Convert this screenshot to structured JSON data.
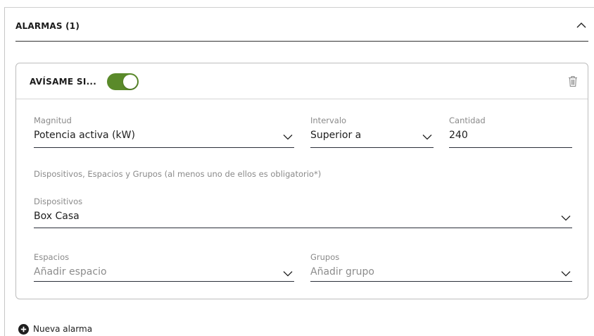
{
  "section": {
    "title": "ALARMAS (1)"
  },
  "alarm": {
    "title": "AVÍSAME SI...",
    "enabled": true,
    "magnitud": {
      "label": "Magnitud",
      "value": "Potencia activa (kW)"
    },
    "intervalo": {
      "label": "Intervalo",
      "value": "Superior a"
    },
    "cantidad": {
      "label": "Cantidad",
      "value": "240"
    },
    "hint": "Dispositivos, Espacios y Grupos (al menos uno de ellos es obligatorio*)",
    "dispositivos": {
      "label": "Dispositivos",
      "value": "Box Casa"
    },
    "espacios": {
      "label": "Espacios",
      "placeholder": "Añadir espacio"
    },
    "grupos": {
      "label": "Grupos",
      "placeholder": "Añadir grupo"
    }
  },
  "add_alarm": {
    "label": "Nueva alarma"
  },
  "icons": {
    "collapse": "chevron-up-icon",
    "delete": "trash-icon",
    "dropdown": "chevron-down-icon",
    "add": "plus-circle-icon"
  },
  "colors": {
    "toggle_on": "#5a8a2a",
    "field_underline": "#2b2f3a",
    "label_gray": "#8a8a8a"
  }
}
